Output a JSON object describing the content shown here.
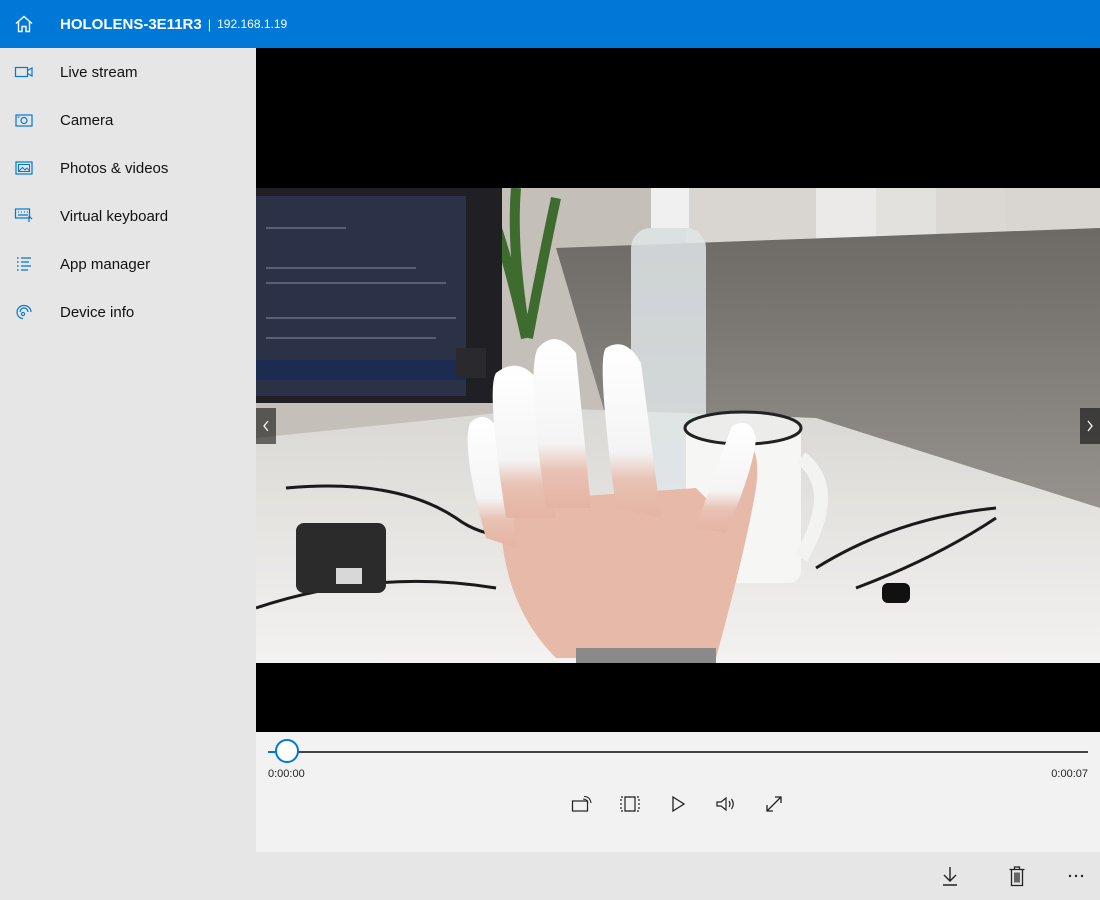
{
  "header": {
    "device_name": "HOLOLENS-3E11R3",
    "separator": "|",
    "ip_address": "192.168.1.19"
  },
  "sidebar": {
    "items": [
      {
        "label": "Live stream",
        "icon": "video-camera-icon"
      },
      {
        "label": "Camera",
        "icon": "camera-icon"
      },
      {
        "label": "Photos & videos",
        "icon": "photos-icon"
      },
      {
        "label": "Virtual keyboard",
        "icon": "keyboard-icon"
      },
      {
        "label": "App manager",
        "icon": "list-icon"
      },
      {
        "label": "Device info",
        "icon": "headset-icon"
      }
    ]
  },
  "player": {
    "current_time": "0:00:00",
    "total_time": "0:00:07",
    "progress": 0.023
  },
  "colors": {
    "accent": "#0078d7",
    "sidebar_bg": "#e6e6e6",
    "content_bg": "#f2f2f2"
  }
}
